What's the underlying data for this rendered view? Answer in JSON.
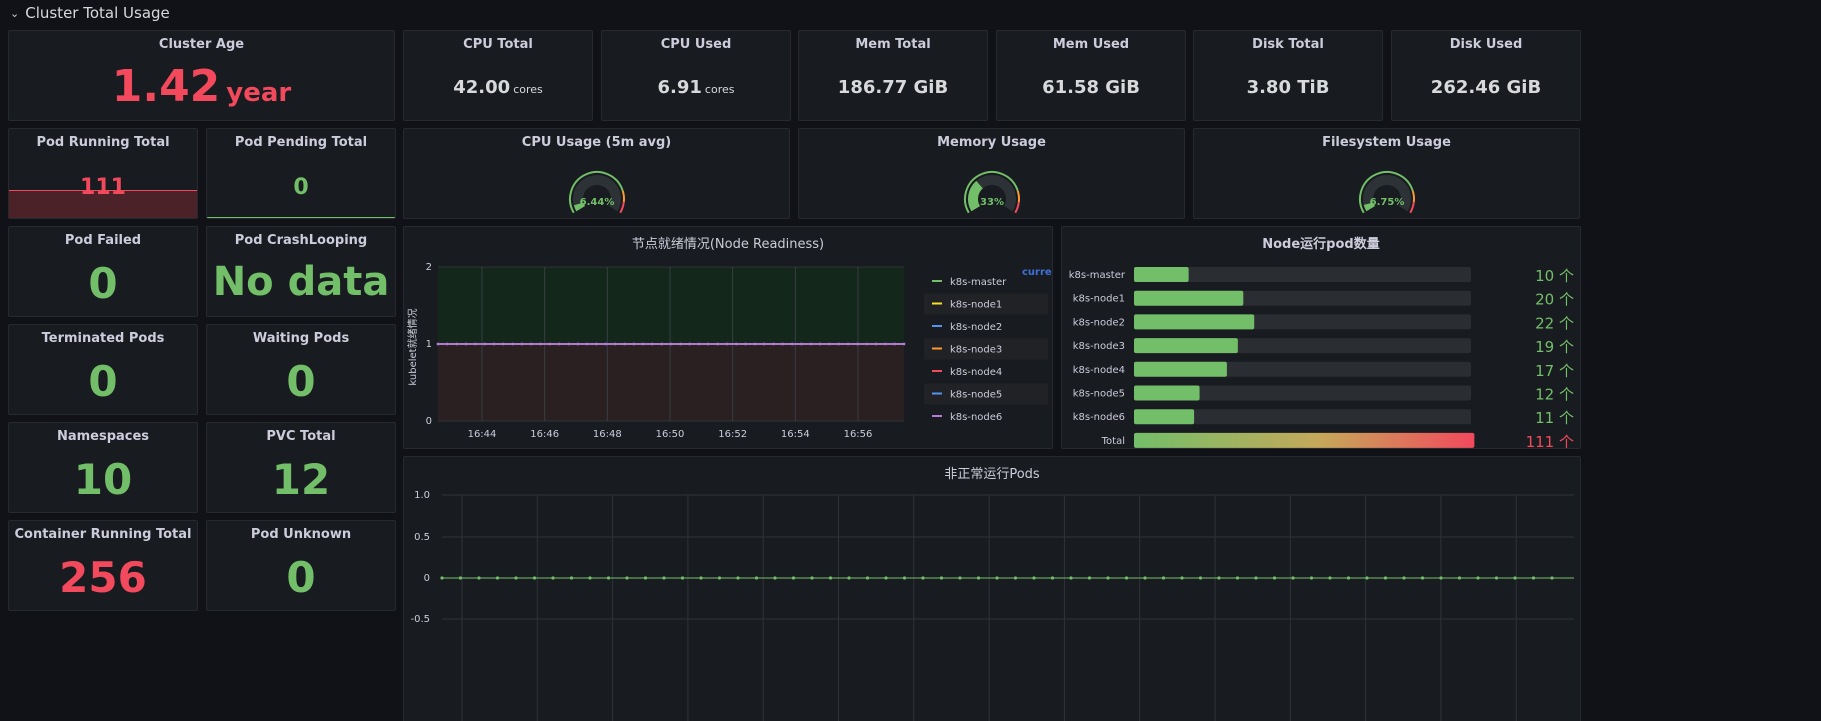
{
  "row": {
    "title": "Cluster Total Usage"
  },
  "panels": {
    "cluster_age": {
      "title": "Cluster Age",
      "value": "1.42",
      "unit": "year"
    },
    "cpu_total": {
      "title": "CPU Total",
      "value": "42.00",
      "unit": "cores"
    },
    "cpu_used": {
      "title": "CPU Used",
      "value": "6.91",
      "unit": "cores"
    },
    "mem_total": {
      "title": "Mem Total",
      "value": "186.77 GiB"
    },
    "mem_used": {
      "title": "Mem Used",
      "value": "61.58 GiB"
    },
    "disk_total": {
      "title": "Disk Total",
      "value": "3.80 TiB"
    },
    "disk_used": {
      "title": "Disk Used",
      "value": "262.46 GiB"
    },
    "pod_running": {
      "title": "Pod Running Total",
      "value": "111"
    },
    "pod_pending": {
      "title": "Pod Pending Total",
      "value": "0"
    },
    "pod_failed": {
      "title": "Pod Failed",
      "value": "0"
    },
    "pod_crashlooping": {
      "title": "Pod CrashLooping",
      "value": "No data"
    },
    "terminated_pods": {
      "title": "Terminated Pods",
      "value": "0"
    },
    "waiting_pods": {
      "title": "Waiting Pods",
      "value": "0"
    },
    "namespaces": {
      "title": "Namespaces",
      "value": "10"
    },
    "pvc_total": {
      "title": "PVC Total",
      "value": "12"
    },
    "container_running": {
      "title": "Container Running Total",
      "value": "256"
    },
    "pod_unknown": {
      "title": "Pod Unknown",
      "value": "0"
    }
  },
  "gauges": {
    "cpu": {
      "title": "CPU Usage (5m avg)",
      "label": "6.44%",
      "value": 6.44
    },
    "memory": {
      "title": "Memory Usage",
      "label": "33%",
      "value": 33
    },
    "filesystem": {
      "title": "Filesystem Usage",
      "label": "6.75%",
      "value": 6.75
    }
  },
  "colors": {
    "green": "#73bf69",
    "red": "#f2495c",
    "orange": "#ff9830",
    "track": "#2c3235"
  },
  "chart_data": [
    {
      "type": "line",
      "title": "节点就绪情况(Node Readiness)",
      "ylabel": "kubelet就绪情况",
      "ylim": [
        0,
        2
      ],
      "yticks": [
        "0",
        "1",
        "2"
      ],
      "x": [
        "16:44",
        "16:46",
        "16:48",
        "16:50",
        "16:52",
        "16:54",
        "16:56"
      ],
      "legend_header": "currer",
      "series": [
        {
          "name": "k8s-master",
          "value": 1,
          "color": "#73bf69"
        },
        {
          "name": "k8s-node1",
          "value": 1,
          "color": "#fade2a"
        },
        {
          "name": "k8s-node2",
          "value": 1,
          "color": "#5794f2"
        },
        {
          "name": "k8s-node3",
          "value": 1,
          "color": "#ff9830"
        },
        {
          "name": "k8s-node4",
          "value": 1,
          "color": "#f2495c"
        },
        {
          "name": "k8s-node5",
          "value": 1,
          "color": "#5794f2"
        },
        {
          "name": "k8s-node6",
          "value": 1,
          "color": "#b877d9"
        }
      ]
    },
    {
      "type": "bar",
      "title": "Node运行pod数量",
      "categories": [
        "k8s-master",
        "k8s-node1",
        "k8s-node2",
        "k8s-node3",
        "k8s-node4",
        "k8s-node5",
        "k8s-node6",
        "Total"
      ],
      "values": [
        10,
        20,
        22,
        19,
        17,
        12,
        11,
        111
      ],
      "labels": [
        "10 个",
        "20 个",
        "22 个",
        "19 个",
        "17 个",
        "12 个",
        "11 个",
        "111 个"
      ]
    },
    {
      "type": "line",
      "title": "非正常运行Pods",
      "yticks": [
        "1.0",
        "0.5",
        "0",
        "-0.5"
      ],
      "series": [
        {
          "values": 0,
          "color": "#73bf69"
        }
      ]
    }
  ]
}
